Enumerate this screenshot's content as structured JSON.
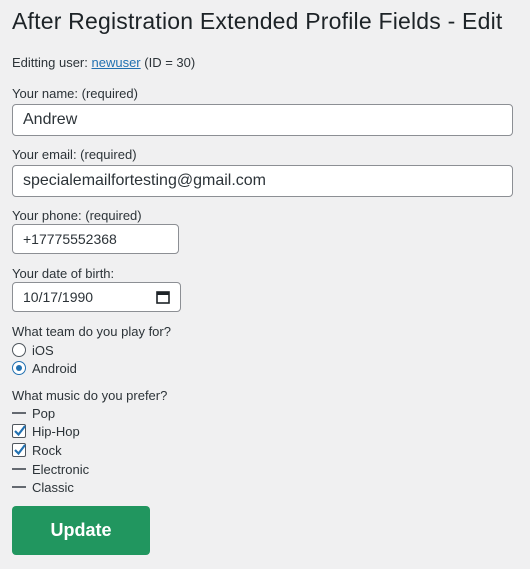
{
  "page": {
    "title": "After Registration Extended Profile Fields - Edit"
  },
  "user_line": {
    "prefix": "Editting user:",
    "username": "newuser",
    "suffix": "(ID = 30)"
  },
  "fields": {
    "name": {
      "label": "Your name: (required)",
      "value": "Andrew"
    },
    "email": {
      "label": "Your email: (required)",
      "value": "specialemailfortesting@gmail.com"
    },
    "phone": {
      "label": "Your phone: (required)",
      "value": "+17775552368"
    },
    "dob": {
      "label": "Your date of birth:",
      "value": "10/17/1990"
    }
  },
  "team": {
    "label": "What team do you play for?",
    "options": [
      {
        "label": "iOS",
        "selected": false
      },
      {
        "label": "Android",
        "selected": true
      }
    ]
  },
  "music": {
    "label": "What music do you prefer?",
    "options": [
      {
        "label": "Pop",
        "state": "indeterminate"
      },
      {
        "label": "Hip-Hop",
        "state": "checked"
      },
      {
        "label": "Rock",
        "state": "checked"
      },
      {
        "label": "Electronic",
        "state": "indeterminate"
      },
      {
        "label": "Classic",
        "state": "indeterminate"
      }
    ]
  },
  "actions": {
    "update_label": "Update"
  },
  "colors": {
    "accent": "#2271b1",
    "button": "#21965f",
    "background": "#f0f0f1"
  }
}
